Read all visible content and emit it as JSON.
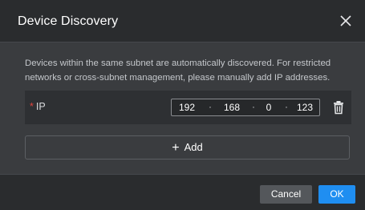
{
  "dialog": {
    "title": "Device Discovery",
    "close_icon": "close-icon",
    "description": "Devices within the same subnet are automatically discovered. For restricted networks or cross-subnet management, please manually add IP addresses."
  },
  "ip_row": {
    "required_mark": "*",
    "label": "IP",
    "octets": [
      "192",
      "168",
      "0",
      "123"
    ],
    "separator": "·",
    "delete_icon": "trash-icon"
  },
  "add_button": {
    "icon": "plus-icon",
    "plus": "+",
    "label": "Add"
  },
  "footer": {
    "cancel_label": "Cancel",
    "ok_label": "OK"
  },
  "colors": {
    "accent": "#1f8ef1",
    "required": "#e0443e",
    "background": "#3a3c3f"
  }
}
